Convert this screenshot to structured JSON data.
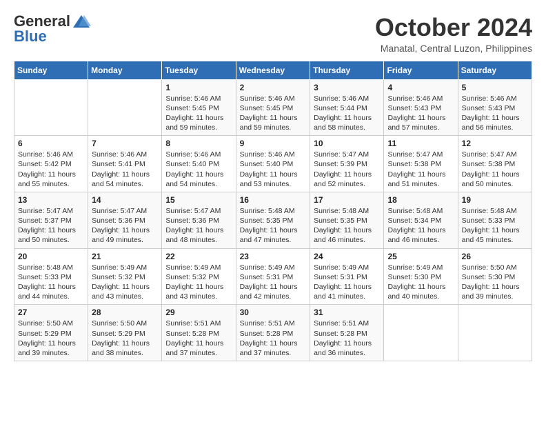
{
  "header": {
    "logo_general": "General",
    "logo_blue": "Blue",
    "month_title": "October 2024",
    "subtitle": "Manatal, Central Luzon, Philippines"
  },
  "weekdays": [
    "Sunday",
    "Monday",
    "Tuesday",
    "Wednesday",
    "Thursday",
    "Friday",
    "Saturday"
  ],
  "weeks": [
    [
      {
        "day": "",
        "sunrise": "",
        "sunset": "",
        "daylight": ""
      },
      {
        "day": "",
        "sunrise": "",
        "sunset": "",
        "daylight": ""
      },
      {
        "day": "1",
        "sunrise": "Sunrise: 5:46 AM",
        "sunset": "Sunset: 5:45 PM",
        "daylight": "Daylight: 11 hours and 59 minutes."
      },
      {
        "day": "2",
        "sunrise": "Sunrise: 5:46 AM",
        "sunset": "Sunset: 5:45 PM",
        "daylight": "Daylight: 11 hours and 59 minutes."
      },
      {
        "day": "3",
        "sunrise": "Sunrise: 5:46 AM",
        "sunset": "Sunset: 5:44 PM",
        "daylight": "Daylight: 11 hours and 58 minutes."
      },
      {
        "day": "4",
        "sunrise": "Sunrise: 5:46 AM",
        "sunset": "Sunset: 5:43 PM",
        "daylight": "Daylight: 11 hours and 57 minutes."
      },
      {
        "day": "5",
        "sunrise": "Sunrise: 5:46 AM",
        "sunset": "Sunset: 5:43 PM",
        "daylight": "Daylight: 11 hours and 56 minutes."
      }
    ],
    [
      {
        "day": "6",
        "sunrise": "Sunrise: 5:46 AM",
        "sunset": "Sunset: 5:42 PM",
        "daylight": "Daylight: 11 hours and 55 minutes."
      },
      {
        "day": "7",
        "sunrise": "Sunrise: 5:46 AM",
        "sunset": "Sunset: 5:41 PM",
        "daylight": "Daylight: 11 hours and 54 minutes."
      },
      {
        "day": "8",
        "sunrise": "Sunrise: 5:46 AM",
        "sunset": "Sunset: 5:40 PM",
        "daylight": "Daylight: 11 hours and 54 minutes."
      },
      {
        "day": "9",
        "sunrise": "Sunrise: 5:46 AM",
        "sunset": "Sunset: 5:40 PM",
        "daylight": "Daylight: 11 hours and 53 minutes."
      },
      {
        "day": "10",
        "sunrise": "Sunrise: 5:47 AM",
        "sunset": "Sunset: 5:39 PM",
        "daylight": "Daylight: 11 hours and 52 minutes."
      },
      {
        "day": "11",
        "sunrise": "Sunrise: 5:47 AM",
        "sunset": "Sunset: 5:38 PM",
        "daylight": "Daylight: 11 hours and 51 minutes."
      },
      {
        "day": "12",
        "sunrise": "Sunrise: 5:47 AM",
        "sunset": "Sunset: 5:38 PM",
        "daylight": "Daylight: 11 hours and 50 minutes."
      }
    ],
    [
      {
        "day": "13",
        "sunrise": "Sunrise: 5:47 AM",
        "sunset": "Sunset: 5:37 PM",
        "daylight": "Daylight: 11 hours and 50 minutes."
      },
      {
        "day": "14",
        "sunrise": "Sunrise: 5:47 AM",
        "sunset": "Sunset: 5:36 PM",
        "daylight": "Daylight: 11 hours and 49 minutes."
      },
      {
        "day": "15",
        "sunrise": "Sunrise: 5:47 AM",
        "sunset": "Sunset: 5:36 PM",
        "daylight": "Daylight: 11 hours and 48 minutes."
      },
      {
        "day": "16",
        "sunrise": "Sunrise: 5:48 AM",
        "sunset": "Sunset: 5:35 PM",
        "daylight": "Daylight: 11 hours and 47 minutes."
      },
      {
        "day": "17",
        "sunrise": "Sunrise: 5:48 AM",
        "sunset": "Sunset: 5:35 PM",
        "daylight": "Daylight: 11 hours and 46 minutes."
      },
      {
        "day": "18",
        "sunrise": "Sunrise: 5:48 AM",
        "sunset": "Sunset: 5:34 PM",
        "daylight": "Daylight: 11 hours and 46 minutes."
      },
      {
        "day": "19",
        "sunrise": "Sunrise: 5:48 AM",
        "sunset": "Sunset: 5:33 PM",
        "daylight": "Daylight: 11 hours and 45 minutes."
      }
    ],
    [
      {
        "day": "20",
        "sunrise": "Sunrise: 5:48 AM",
        "sunset": "Sunset: 5:33 PM",
        "daylight": "Daylight: 11 hours and 44 minutes."
      },
      {
        "day": "21",
        "sunrise": "Sunrise: 5:49 AM",
        "sunset": "Sunset: 5:32 PM",
        "daylight": "Daylight: 11 hours and 43 minutes."
      },
      {
        "day": "22",
        "sunrise": "Sunrise: 5:49 AM",
        "sunset": "Sunset: 5:32 PM",
        "daylight": "Daylight: 11 hours and 43 minutes."
      },
      {
        "day": "23",
        "sunrise": "Sunrise: 5:49 AM",
        "sunset": "Sunset: 5:31 PM",
        "daylight": "Daylight: 11 hours and 42 minutes."
      },
      {
        "day": "24",
        "sunrise": "Sunrise: 5:49 AM",
        "sunset": "Sunset: 5:31 PM",
        "daylight": "Daylight: 11 hours and 41 minutes."
      },
      {
        "day": "25",
        "sunrise": "Sunrise: 5:49 AM",
        "sunset": "Sunset: 5:30 PM",
        "daylight": "Daylight: 11 hours and 40 minutes."
      },
      {
        "day": "26",
        "sunrise": "Sunrise: 5:50 AM",
        "sunset": "Sunset: 5:30 PM",
        "daylight": "Daylight: 11 hours and 39 minutes."
      }
    ],
    [
      {
        "day": "27",
        "sunrise": "Sunrise: 5:50 AM",
        "sunset": "Sunset: 5:29 PM",
        "daylight": "Daylight: 11 hours and 39 minutes."
      },
      {
        "day": "28",
        "sunrise": "Sunrise: 5:50 AM",
        "sunset": "Sunset: 5:29 PM",
        "daylight": "Daylight: 11 hours and 38 minutes."
      },
      {
        "day": "29",
        "sunrise": "Sunrise: 5:51 AM",
        "sunset": "Sunset: 5:28 PM",
        "daylight": "Daylight: 11 hours and 37 minutes."
      },
      {
        "day": "30",
        "sunrise": "Sunrise: 5:51 AM",
        "sunset": "Sunset: 5:28 PM",
        "daylight": "Daylight: 11 hours and 37 minutes."
      },
      {
        "day": "31",
        "sunrise": "Sunrise: 5:51 AM",
        "sunset": "Sunset: 5:28 PM",
        "daylight": "Daylight: 11 hours and 36 minutes."
      },
      {
        "day": "",
        "sunrise": "",
        "sunset": "",
        "daylight": ""
      },
      {
        "day": "",
        "sunrise": "",
        "sunset": "",
        "daylight": ""
      }
    ]
  ]
}
